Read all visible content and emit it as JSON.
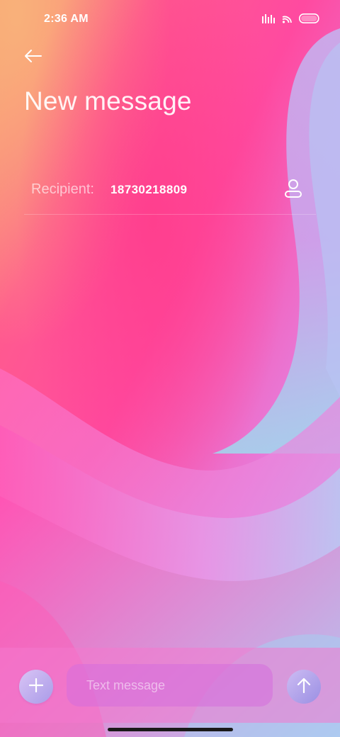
{
  "status_bar": {
    "time": "2:36 AM",
    "icons": [
      "signal-icon",
      "wifi-icon",
      "battery-icon"
    ]
  },
  "header": {
    "back_icon": "back-arrow-icon",
    "title": "New message"
  },
  "recipient": {
    "label": "Recipient:",
    "value": "18730218809",
    "contact_icon": "contact-person-icon"
  },
  "composer": {
    "attach_icon": "plus-icon",
    "input_placeholder": "Text message",
    "input_value": "",
    "send_icon": "send-arrow-up-icon"
  },
  "colors": {
    "background_top_left": "#f7a46f",
    "background_center": "#ff3d96",
    "background_bottom_right": "#8fd8ee",
    "composer_bar": "#f478ce",
    "button_fill": "#b3a5ec"
  }
}
